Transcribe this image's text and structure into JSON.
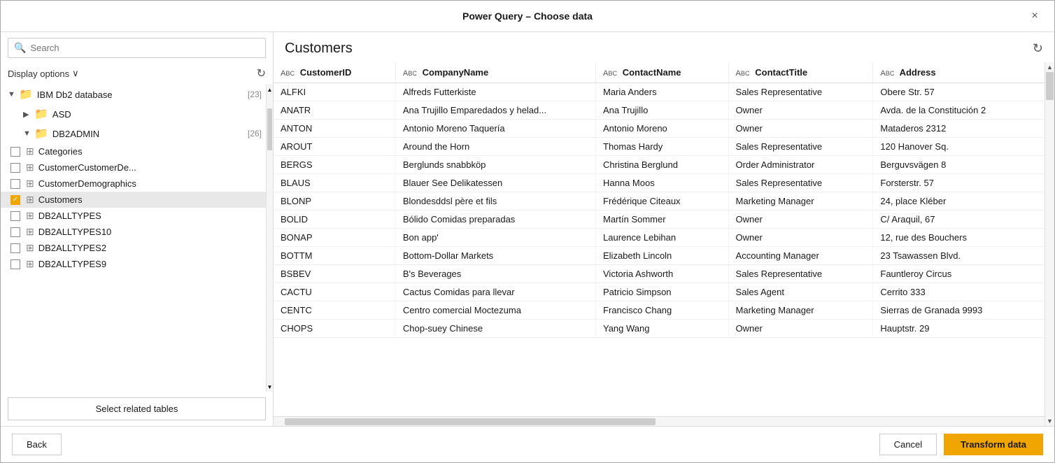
{
  "dialog": {
    "title": "Power Query – Choose data",
    "close_label": "×"
  },
  "left_panel": {
    "search_placeholder": "Search",
    "display_options_label": "Display options",
    "chevron": "∨",
    "refresh_icon": "↻",
    "tree": {
      "root": {
        "label": "IBM Db2 database",
        "count": "[23]",
        "expanded": true,
        "children": [
          {
            "label": "ASD",
            "expanded": false,
            "children": []
          },
          {
            "label": "DB2ADMIN",
            "count": "[26]",
            "expanded": true,
            "children": [
              {
                "label": "Categories",
                "checked": false
              },
              {
                "label": "CustomerCustomerDe...",
                "checked": false
              },
              {
                "label": "CustomerDemographics",
                "checked": false
              },
              {
                "label": "Customers",
                "checked": true,
                "selected": true
              },
              {
                "label": "DB2ALLTYPES",
                "checked": false
              },
              {
                "label": "DB2ALLTYPES10",
                "checked": false
              },
              {
                "label": "DB2ALLTYPES2",
                "checked": false
              },
              {
                "label": "DB2ALLTYPES9",
                "checked": false
              }
            ]
          }
        ]
      }
    },
    "select_related_label": "Select related tables"
  },
  "right_panel": {
    "title": "Customers",
    "refresh_icon": "↻",
    "columns": [
      {
        "name": "CustomerID",
        "type": "ABC"
      },
      {
        "name": "CompanyName",
        "type": "ABC"
      },
      {
        "name": "ContactName",
        "type": "ABC"
      },
      {
        "name": "ContactTitle",
        "type": "ABC"
      },
      {
        "name": "Address",
        "type": "ABC"
      }
    ],
    "rows": [
      [
        "ALFKI",
        "Alfreds Futterkiste",
        "Maria Anders",
        "Sales Representative",
        "Obere Str. 57"
      ],
      [
        "ANATR",
        "Ana Trujillo Emparedados y helad...",
        "Ana Trujillo",
        "Owner",
        "Avda. de la Constitución 2"
      ],
      [
        "ANTON",
        "Antonio Moreno Taquería",
        "Antonio Moreno",
        "Owner",
        "Mataderos 2312"
      ],
      [
        "AROUT",
        "Around the Horn",
        "Thomas Hardy",
        "Sales Representative",
        "120 Hanover Sq."
      ],
      [
        "BERGS",
        "Berglunds snabbköp",
        "Christina Berglund",
        "Order Administrator",
        "Berguvsvägen 8"
      ],
      [
        "BLAUS",
        "Blauer See Delikatessen",
        "Hanna Moos",
        "Sales Representative",
        "Forsterstr. 57"
      ],
      [
        "BLONP",
        "Blondesddsl père et fils",
        "Frédérique Citeaux",
        "Marketing Manager",
        "24, place Kléber"
      ],
      [
        "BOLID",
        "Bólido Comidas preparadas",
        "Martín Sommer",
        "Owner",
        "C/ Araquil, 67"
      ],
      [
        "BONAP",
        "Bon app'",
        "Laurence Lebihan",
        "Owner",
        "12, rue des Bouchers"
      ],
      [
        "BOTTM",
        "Bottom-Dollar Markets",
        "Elizabeth Lincoln",
        "Accounting Manager",
        "23 Tsawassen Blvd."
      ],
      [
        "BSBEV",
        "B's Beverages",
        "Victoria Ashworth",
        "Sales Representative",
        "Fauntleroy Circus"
      ],
      [
        "CACTU",
        "Cactus Comidas para llevar",
        "Patricio Simpson",
        "Sales Agent",
        "Cerrito 333"
      ],
      [
        "CENTC",
        "Centro comercial Moctezuma",
        "Francisco Chang",
        "Marketing Manager",
        "Sierras de Granada 9993"
      ],
      [
        "CHOPS",
        "Chop-suey Chinese",
        "Yang Wang",
        "Owner",
        "Hauptstr. 29"
      ]
    ]
  },
  "footer": {
    "back_label": "Back",
    "cancel_label": "Cancel",
    "transform_label": "Transform data"
  }
}
